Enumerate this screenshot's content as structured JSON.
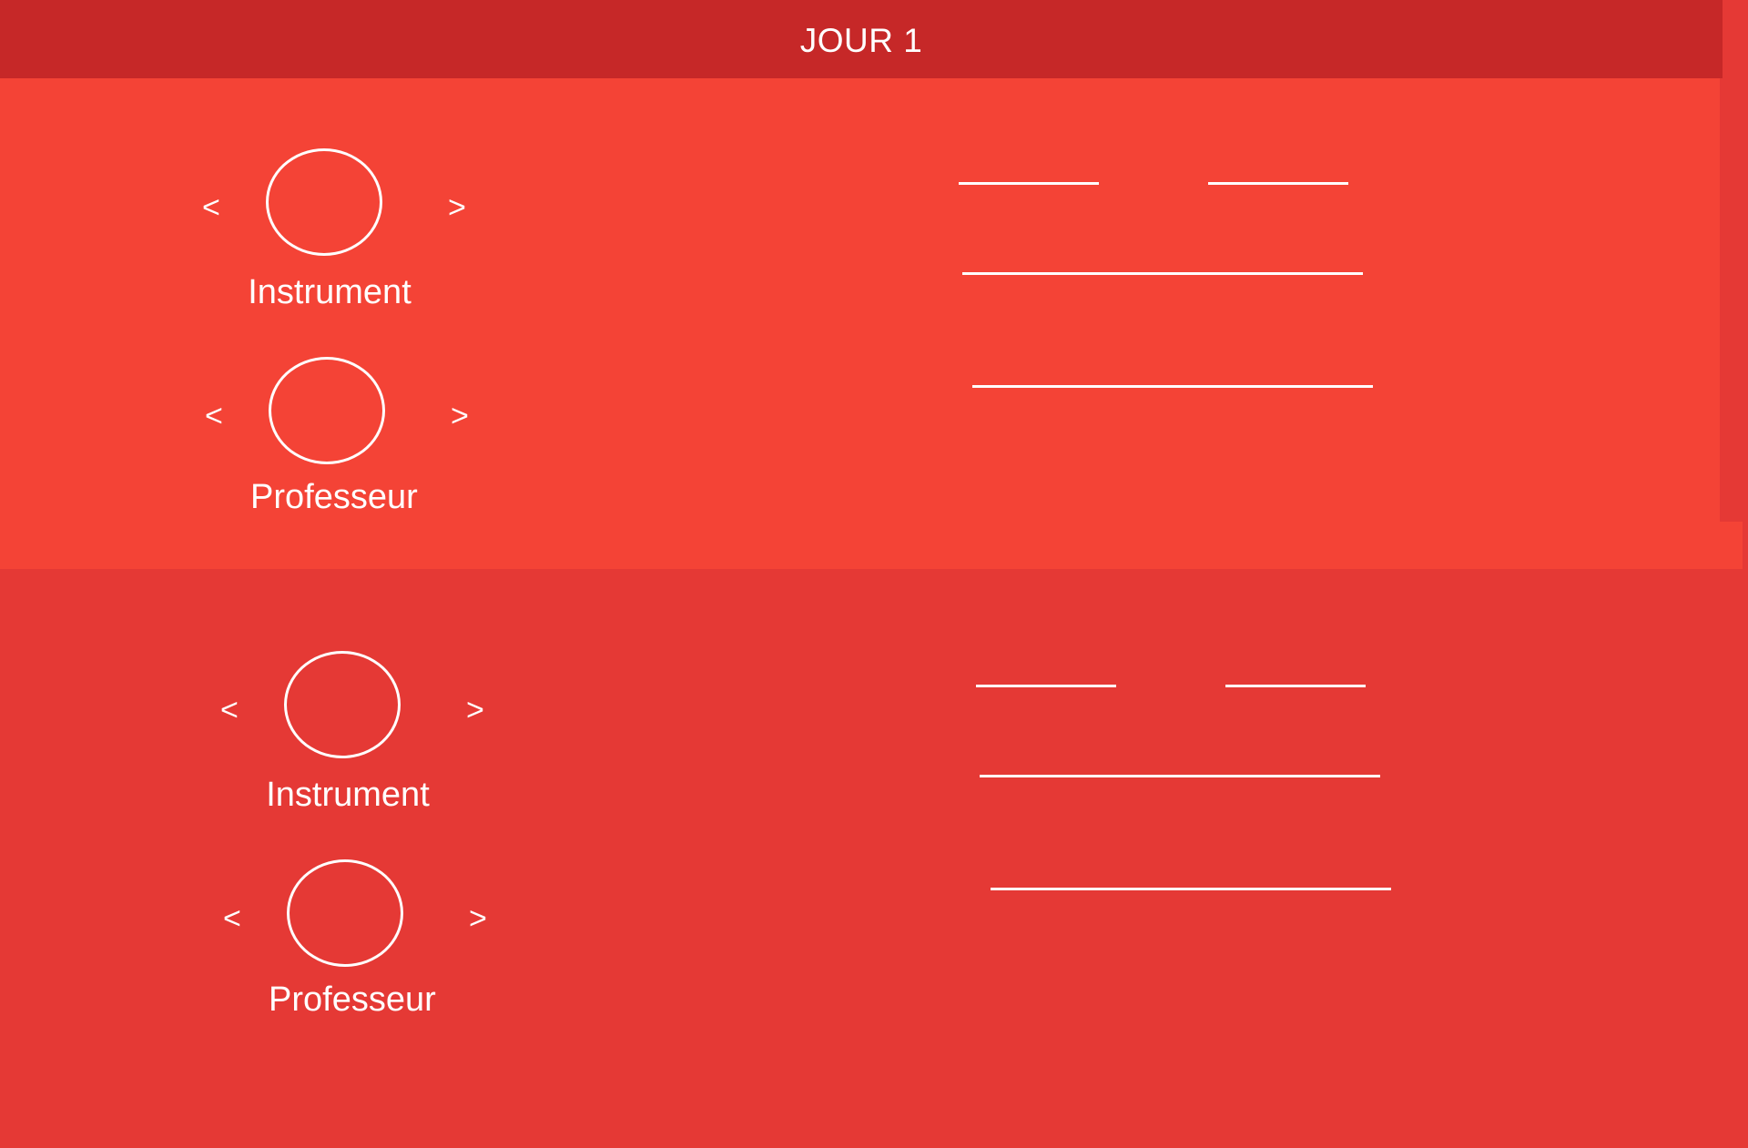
{
  "header": {
    "title": "JOUR 1"
  },
  "slots": [
    {
      "instrument": {
        "prev_label": "<",
        "next_label": ">",
        "label": "Instrument"
      },
      "professeur": {
        "prev_label": "<",
        "next_label": ">",
        "label": "Professeur"
      }
    },
    {
      "instrument": {
        "prev_label": "<",
        "next_label": ">",
        "label": "Instrument"
      },
      "professeur": {
        "prev_label": "<",
        "next_label": ">",
        "label": "Professeur"
      }
    }
  ],
  "colors": {
    "header_bg": "#c62828",
    "panel_1_bg": "#f44336",
    "panel_2_bg": "#e53935",
    "foreground": "#ffffff"
  },
  "icons": {
    "prev": "chevron-left-icon",
    "next": "chevron-right-icon",
    "avatar": "avatar-circle-placeholder"
  }
}
